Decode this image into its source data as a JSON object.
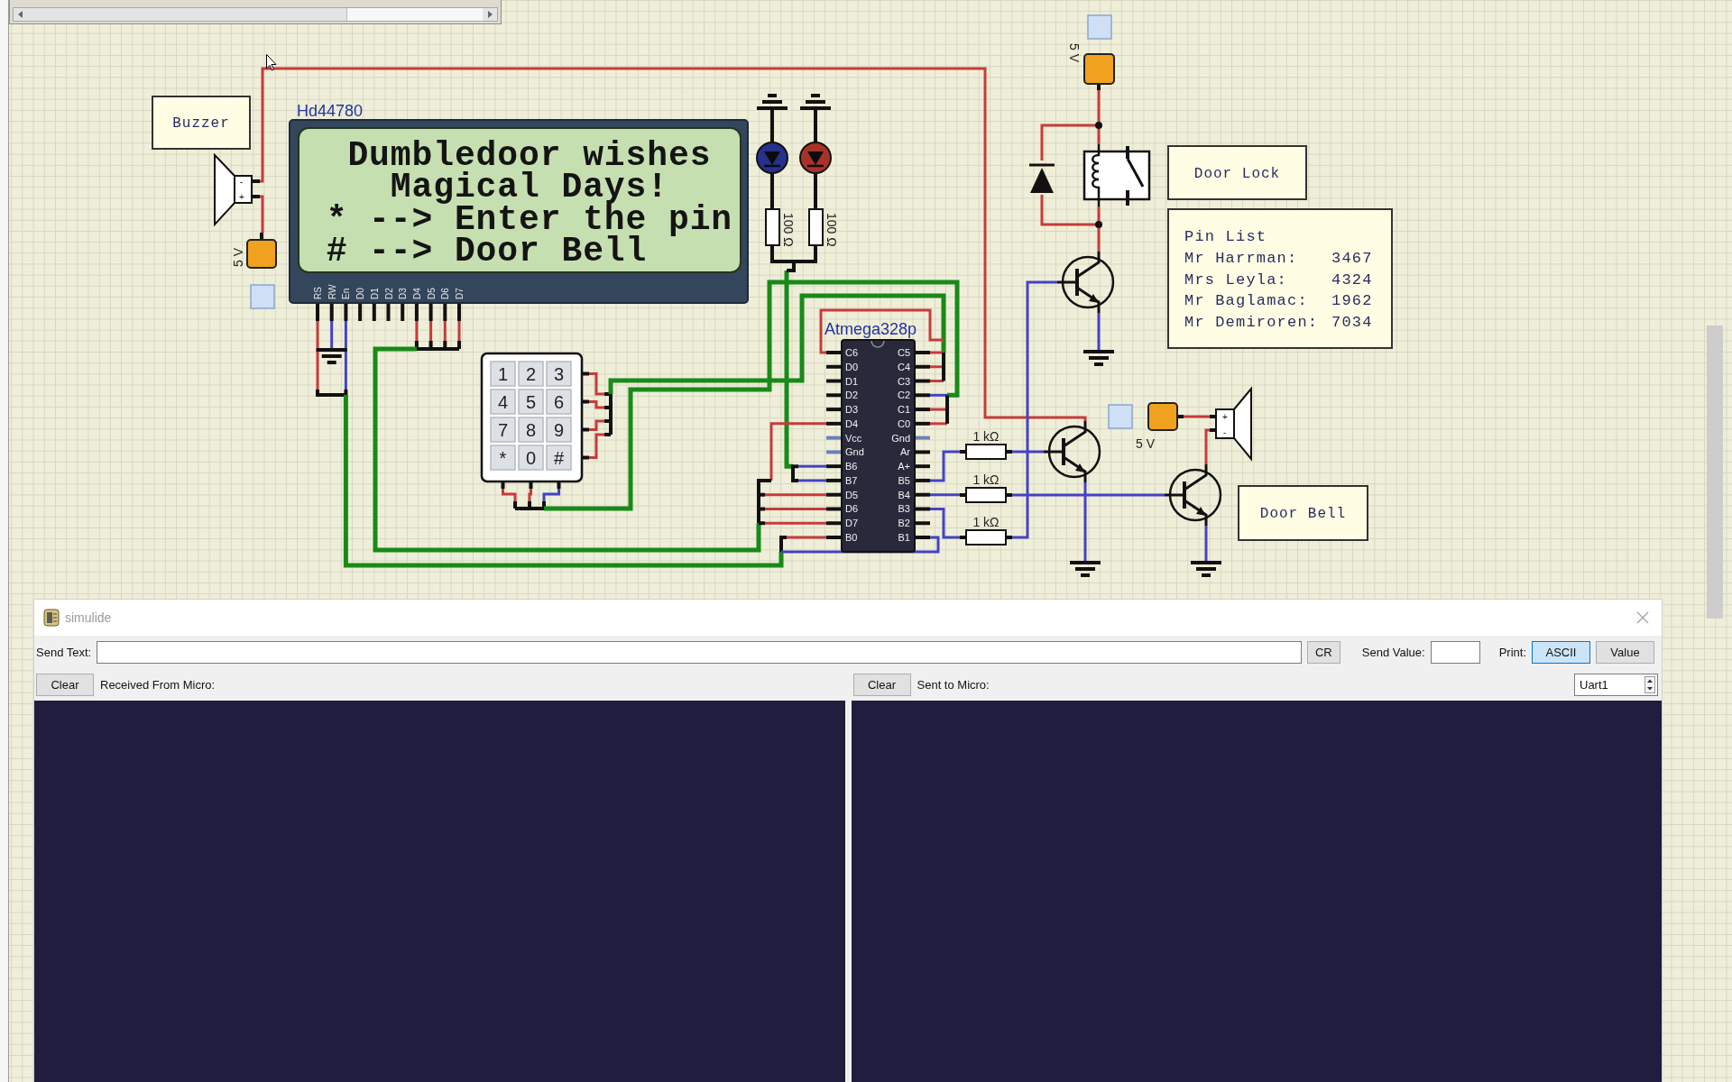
{
  "canvas": {
    "buzzer": {
      "label": "Buzzer",
      "polarity": [
        "-",
        "+"
      ]
    },
    "lcd": {
      "title": "Hd44780",
      "lines": [
        "Dumbledoor wishes",
        "Magical Days!",
        "* --> Enter the pin",
        "# --> Door Bell"
      ],
      "pins": [
        "RS",
        "RW",
        "En",
        "D0",
        "D1",
        "D2",
        "D3",
        "D4",
        "D5",
        "D6",
        "D7"
      ]
    },
    "power_sources": [
      {
        "label": "5 V"
      },
      {
        "label": "5 V"
      },
      {
        "label": "5 V"
      }
    ],
    "leds": [
      {
        "color": "#27318c",
        "resistor": "100 Ω"
      },
      {
        "color": "#a8322a",
        "resistor": "100 Ω"
      }
    ],
    "keypad": {
      "keys": [
        "1",
        "2",
        "3",
        "4",
        "5",
        "6",
        "7",
        "8",
        "9",
        "*",
        "0",
        "#"
      ]
    },
    "mcu": {
      "title": "Atmega328p",
      "left_pins": [
        {
          "label": "C6",
          "kind": "io"
        },
        {
          "label": "D0",
          "kind": "io"
        },
        {
          "label": "D1",
          "kind": "io"
        },
        {
          "label": "D2",
          "kind": "io"
        },
        {
          "label": "D3",
          "kind": "io"
        },
        {
          "label": "D4",
          "kind": "io"
        },
        {
          "label": "Vcc",
          "kind": "power"
        },
        {
          "label": "Gnd",
          "kind": "power"
        },
        {
          "label": "B6",
          "kind": "io"
        },
        {
          "label": "B7",
          "kind": "io"
        },
        {
          "label": "D5",
          "kind": "io"
        },
        {
          "label": "D6",
          "kind": "io"
        },
        {
          "label": "D7",
          "kind": "io"
        },
        {
          "label": "B0",
          "kind": "io"
        }
      ],
      "right_pins": [
        {
          "label": "C5",
          "kind": "io"
        },
        {
          "label": "C4",
          "kind": "io"
        },
        {
          "label": "C3",
          "kind": "io"
        },
        {
          "label": "C2",
          "kind": "io"
        },
        {
          "label": "C1",
          "kind": "io"
        },
        {
          "label": "C0",
          "kind": "io"
        },
        {
          "label": "Gnd",
          "kind": "power"
        },
        {
          "label": "Ar",
          "kind": "io"
        },
        {
          "label": "A+",
          "kind": "io"
        },
        {
          "label": "B5",
          "kind": "io"
        },
        {
          "label": "B4",
          "kind": "io"
        },
        {
          "label": "B3",
          "kind": "io"
        },
        {
          "label": "B2",
          "kind": "io"
        },
        {
          "label": "B1",
          "kind": "io"
        }
      ]
    },
    "base_resistors": [
      {
        "label": "1 kΩ"
      },
      {
        "label": "1 kΩ"
      },
      {
        "label": "1 kΩ"
      }
    ],
    "door_lock": {
      "label": "Door Lock"
    },
    "pin_list": {
      "title": "Pin List",
      "entries": [
        {
          "name": "Mr Harrman:",
          "pin": "3467"
        },
        {
          "name": "Mrs Leyla:",
          "pin": "4324"
        },
        {
          "name": "Mr Baglamac:",
          "pin": "1962"
        },
        {
          "name": "Mr Demiroren:",
          "pin": "7034"
        }
      ]
    },
    "door_bell": {
      "label": "Door Bell",
      "polarity": [
        "+",
        "-"
      ]
    }
  },
  "serial_monitor": {
    "title": "simulide",
    "send_text_label": "Send Text:",
    "cr_button": "CR",
    "send_value_label": "Send Value:",
    "print_label": "Print:",
    "print_modes": [
      {
        "label": "ASCII",
        "selected": true
      },
      {
        "label": "Value",
        "selected": false
      }
    ],
    "panes": [
      {
        "clear_button": "Clear",
        "label": "Received From Micro:"
      },
      {
        "clear_button": "Clear",
        "label": "Sent to Micro:"
      }
    ],
    "port": "Uart1"
  }
}
